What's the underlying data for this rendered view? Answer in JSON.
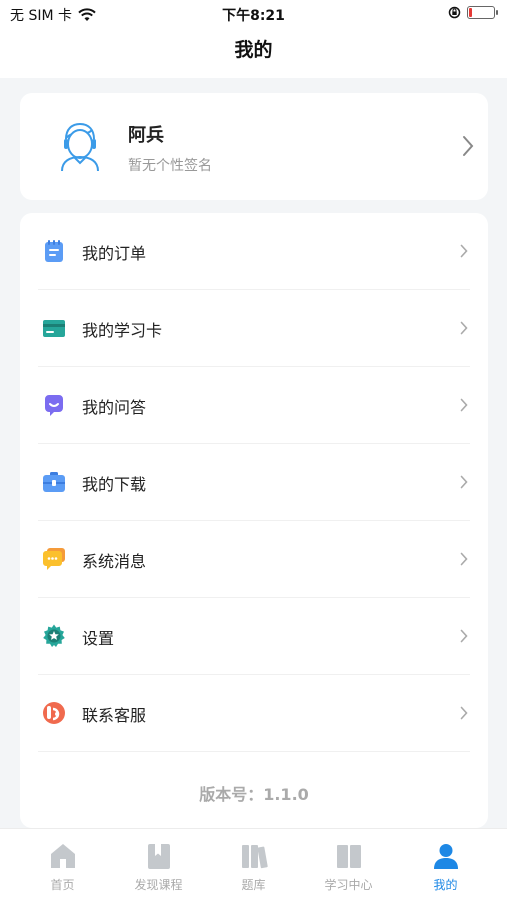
{
  "status": {
    "carrier": "无 SIM 卡",
    "time": "下午8:21",
    "battery_level": 0.12
  },
  "header": {
    "title": "我的"
  },
  "profile": {
    "name": "阿兵",
    "signature": "暂无个性签名"
  },
  "menu": {
    "items": [
      {
        "label": "我的订单",
        "icon": "order-icon"
      },
      {
        "label": "我的学习卡",
        "icon": "study-card-icon"
      },
      {
        "label": "我的问答",
        "icon": "qa-icon"
      },
      {
        "label": "我的下载",
        "icon": "download-icon"
      },
      {
        "label": "系统消息",
        "icon": "message-icon"
      },
      {
        "label": "设置",
        "icon": "settings-icon"
      },
      {
        "label": "联系客服",
        "icon": "customer-service-icon"
      }
    ],
    "version": "版本号：1.1.0"
  },
  "tabbar": {
    "tabs": [
      {
        "label": "首页",
        "icon": "home-icon"
      },
      {
        "label": "发现课程",
        "icon": "discover-icon"
      },
      {
        "label": "题库",
        "icon": "question-bank-icon"
      },
      {
        "label": "学习中心",
        "icon": "study-center-icon"
      },
      {
        "label": "我的",
        "icon": "user-icon"
      }
    ],
    "active_index": 4
  },
  "colors": {
    "accent": "#1e88e5",
    "inactive": "#aaaaaa",
    "background": "#f3f5f7"
  }
}
